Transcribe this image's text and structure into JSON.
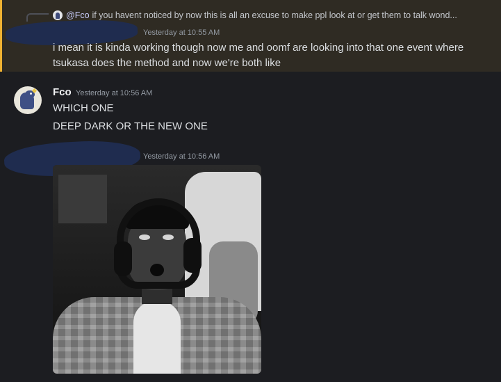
{
  "messages": [
    {
      "reply": {
        "mention": "@Fco",
        "text": "if you havent noticed by now this is all an excuse to make ppl look at or get them to talk wond..."
      },
      "timestamp": "Yesterday at 10:55 AM",
      "lines": [
        "i mean it is kinda working though now me and oomf are looking into that one event where",
        "tsukasa does the method and now we're both like"
      ],
      "highlighted": true
    },
    {
      "author": "Fco",
      "timestamp": "Yesterday at 10:56 AM",
      "lines": [
        "WHICH ONE",
        "DEEP DARK OR THE NEW ONE"
      ]
    },
    {
      "timestamp": "Yesterday at 10:56 AM",
      "attachment": "image"
    }
  ],
  "colors": {
    "background": "#1c1d21",
    "highlight_bg": "#2f2b23",
    "highlight_bar": "#f0b232",
    "mention": "#c9cdfb",
    "redaction": "#1f2c4f"
  },
  "icons": {
    "reply_avatar": "avatar-icon",
    "fco_avatar": "dinosaur-avatar"
  }
}
